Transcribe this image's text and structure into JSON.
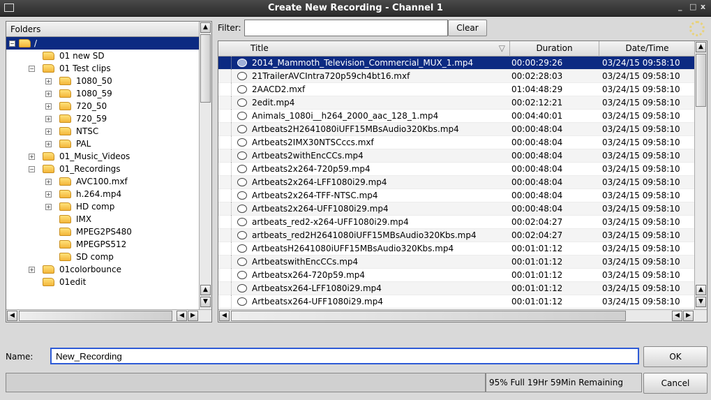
{
  "window": {
    "title": "Create New Recording - Channel 1",
    "minimize": "_",
    "maximize": "□",
    "close": "x"
  },
  "folders": {
    "header": "Folders",
    "items": [
      {
        "label": "/",
        "depth": 0,
        "expander": "−",
        "selected": true
      },
      {
        "label": "01 new SD",
        "depth": 1,
        "expander": ""
      },
      {
        "label": "01 Test clips",
        "depth": 1,
        "expander": "−"
      },
      {
        "label": "1080_50",
        "depth": 2,
        "expander": "+"
      },
      {
        "label": "1080_59",
        "depth": 2,
        "expander": "+"
      },
      {
        "label": "720_50",
        "depth": 2,
        "expander": "+"
      },
      {
        "label": "720_59",
        "depth": 2,
        "expander": "+"
      },
      {
        "label": "NTSC",
        "depth": 2,
        "expander": "+"
      },
      {
        "label": "PAL",
        "depth": 2,
        "expander": "+"
      },
      {
        "label": "01_Music_Videos",
        "depth": 1,
        "expander": "+"
      },
      {
        "label": "01_Recordings",
        "depth": 1,
        "expander": "−"
      },
      {
        "label": "AVC100.mxf",
        "depth": 2,
        "expander": "+"
      },
      {
        "label": "h.264.mp4",
        "depth": 2,
        "expander": "+"
      },
      {
        "label": "HD comp",
        "depth": 2,
        "expander": "+"
      },
      {
        "label": "IMX",
        "depth": 2,
        "expander": ""
      },
      {
        "label": "MPEG2PS480",
        "depth": 2,
        "expander": ""
      },
      {
        "label": "MPEGPS512",
        "depth": 2,
        "expander": ""
      },
      {
        "label": "SD comp",
        "depth": 2,
        "expander": ""
      },
      {
        "label": "01colorbounce",
        "depth": 1,
        "expander": "+"
      },
      {
        "label": "01edit",
        "depth": 1,
        "expander": ""
      }
    ]
  },
  "filter": {
    "label": "Filter:",
    "value": "",
    "clear_label": "Clear"
  },
  "table": {
    "columns": [
      "Title",
      "Duration",
      "Date/Time"
    ],
    "sort_indicator": "▽",
    "rows": [
      {
        "title": "2014_Mammoth_Television_Commercial_MUX_1.mp4",
        "duration": "00:00:29:26",
        "datetime": "03/24/15 09:58:10",
        "selected": true
      },
      {
        "title": "21TrailerAVCIntra720p59ch4bt16.mxf",
        "duration": "00:02:28:03",
        "datetime": "03/24/15 09:58:10"
      },
      {
        "title": "2AACD2.mxf",
        "duration": "01:04:48:29",
        "datetime": "03/24/15 09:58:10"
      },
      {
        "title": "2edit.mp4",
        "duration": "00:02:12:21",
        "datetime": "03/24/15 09:58:10"
      },
      {
        "title": "Animals_1080i__h264_2000_aac_128_1.mp4",
        "duration": "00:04:40:01",
        "datetime": "03/24/15 09:58:10"
      },
      {
        "title": "Artbeats2H2641080iUFF15MBsAudio320Kbs.mp4",
        "duration": "00:00:48:04",
        "datetime": "03/24/15 09:58:10"
      },
      {
        "title": "Artbeats2IMX30NTSCccs.mxf",
        "duration": "00:00:48:04",
        "datetime": "03/24/15 09:58:10"
      },
      {
        "title": "Artbeats2withEncCCs.mp4",
        "duration": "00:00:48:04",
        "datetime": "03/24/15 09:58:10"
      },
      {
        "title": "Artbeats2x264-720p59.mp4",
        "duration": "00:00:48:04",
        "datetime": "03/24/15 09:58:10"
      },
      {
        "title": "Artbeats2x264-LFF1080i29.mp4",
        "duration": "00:00:48:04",
        "datetime": "03/24/15 09:58:10"
      },
      {
        "title": "Artbeats2x264-TFF-NTSC.mp4",
        "duration": "00:00:48:04",
        "datetime": "03/24/15 09:58:10"
      },
      {
        "title": "Artbeats2x264-UFF1080i29.mp4",
        "duration": "00:00:48:04",
        "datetime": "03/24/15 09:58:10"
      },
      {
        "title": "artbeats_red2-x264-UFF1080i29.mp4",
        "duration": "00:02:04:27",
        "datetime": "03/24/15 09:58:10"
      },
      {
        "title": "artbeats_red2H2641080iUFF15MBsAudio320Kbs.mp4",
        "duration": "00:02:04:27",
        "datetime": "03/24/15 09:58:10"
      },
      {
        "title": "ArtbeatsH2641080iUFF15MBsAudio320Kbs.mp4",
        "duration": "00:01:01:12",
        "datetime": "03/24/15 09:58:10"
      },
      {
        "title": "ArtbeatswithEncCCs.mp4",
        "duration": "00:01:01:12",
        "datetime": "03/24/15 09:58:10"
      },
      {
        "title": "Artbeatsx264-720p59.mp4",
        "duration": "00:01:01:12",
        "datetime": "03/24/15 09:58:10"
      },
      {
        "title": "Artbeatsx264-LFF1080i29.mp4",
        "duration": "00:01:01:12",
        "datetime": "03/24/15 09:58:10"
      },
      {
        "title": "Artbeatsx264-UFF1080i29.mp4",
        "duration": "00:01:01:12",
        "datetime": "03/24/15 09:58:10"
      }
    ]
  },
  "name": {
    "label": "Name:",
    "value": "New_Recording"
  },
  "buttons": {
    "ok": "OK",
    "cancel": "Cancel"
  },
  "status": {
    "storage_text": "95% Full  19Hr 59Min Remaining"
  },
  "colors": {
    "selection": "#0c2a82",
    "focus_border": "#2e5bd6",
    "titlebar": "#2b2b2b"
  }
}
